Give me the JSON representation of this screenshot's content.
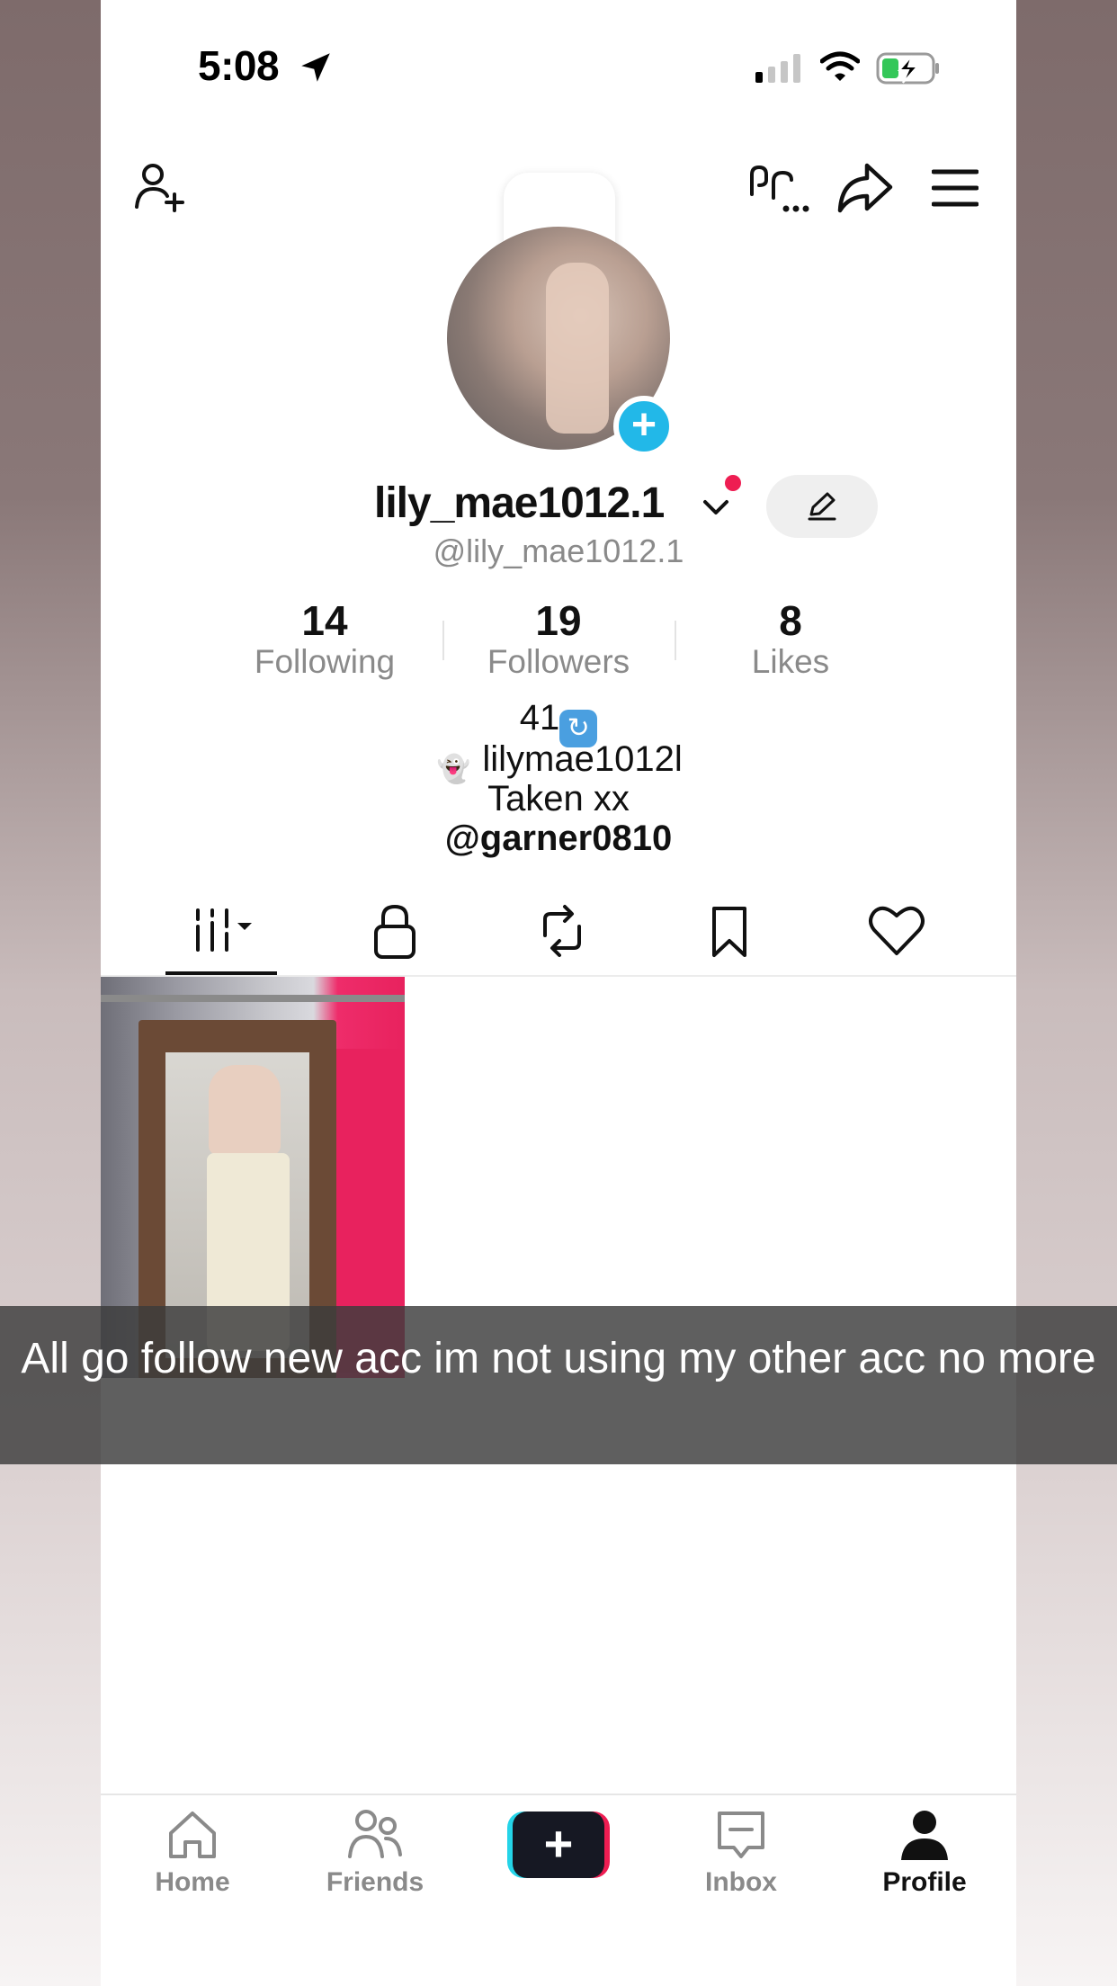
{
  "status_bar": {
    "time": "5:08"
  },
  "profile": {
    "display_name": "lily_mae1012.1",
    "handle": "@lily_mae1012.1"
  },
  "stats": [
    {
      "value": "14",
      "label": "Following"
    },
    {
      "value": "19",
      "label": "Followers"
    },
    {
      "value": "8",
      "label": "Likes"
    }
  ],
  "bio": {
    "line1": "41",
    "line2": "lilymae1012l",
    "line3": "Taken xx",
    "line4": "@garner0810"
  },
  "tabs": [
    "grid-icon",
    "lock-icon",
    "repost-icon",
    "bookmark-icon",
    "heart-icon"
  ],
  "caption": "All go follow new acc im not using my other acc no more",
  "bottom_nav": {
    "home": "Home",
    "friends": "Friends",
    "inbox": "Inbox",
    "profile": "Profile",
    "create": "+"
  },
  "colors": {
    "accent_red": "#ee1d52",
    "accent_cyan": "#25d4e8",
    "avatar_add_blue": "#22b8e8"
  }
}
